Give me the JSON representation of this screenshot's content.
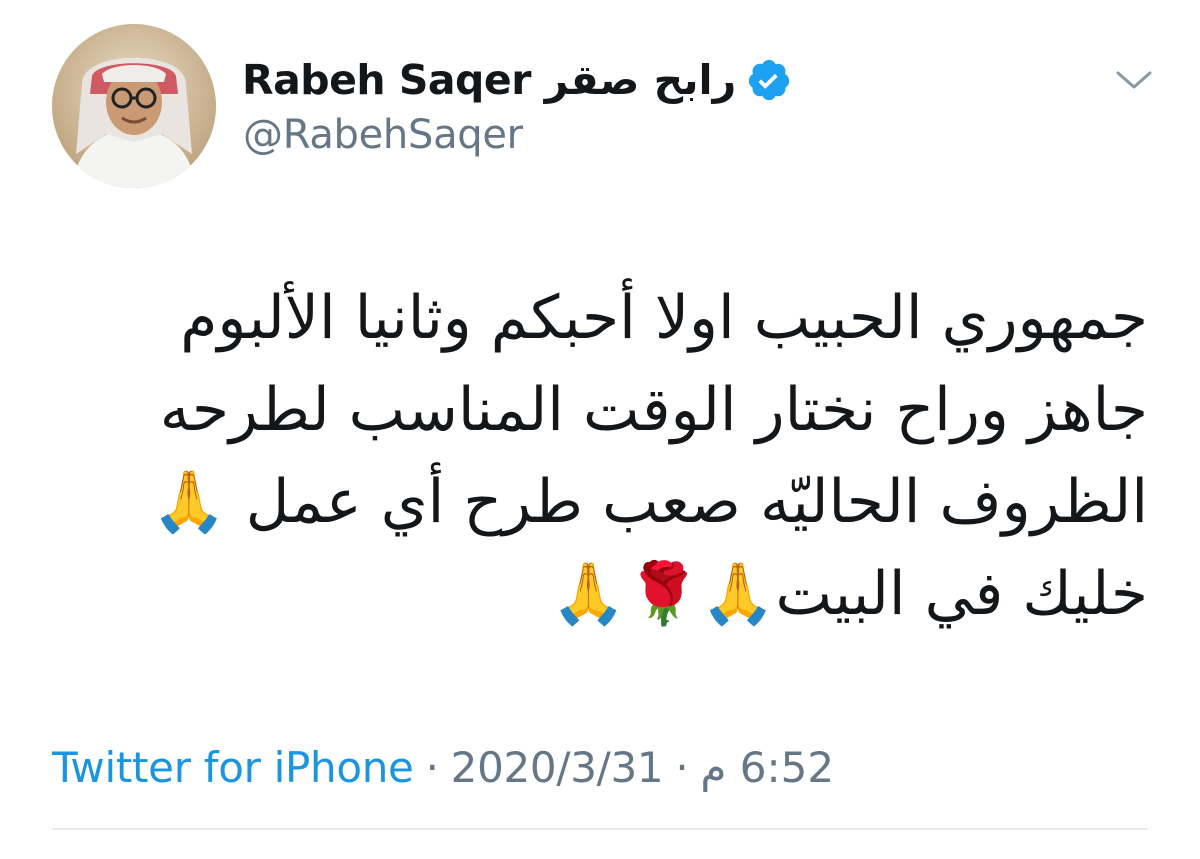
{
  "author": {
    "display_name": "Rabeh Saqer رابح صقر",
    "handle": "@RabehSaqer",
    "verified": true
  },
  "icons": {
    "verified": "verified-badge-icon",
    "caret": "chevron-down-icon",
    "avatar": "profile-photo"
  },
  "tweet": {
    "lines": [
      "جمهوري الحبيب اولا أحبكم وثانيا الألبوم",
      "جاهز وراح نختار الوقت المناسب لطرحه",
      "الظروف الحاليّه صعب طرح أي عمل 🙏",
      "خليك في البيت🙏🌹🙏"
    ]
  },
  "meta": {
    "source": "Twitter for iPhone",
    "separator": "·",
    "date": "2020/3/31",
    "time": "6:52 م"
  },
  "colors": {
    "link": "#1b95e0",
    "secondary": "#657786",
    "verified": "#1da1f2",
    "divider": "#e6ecf0"
  }
}
